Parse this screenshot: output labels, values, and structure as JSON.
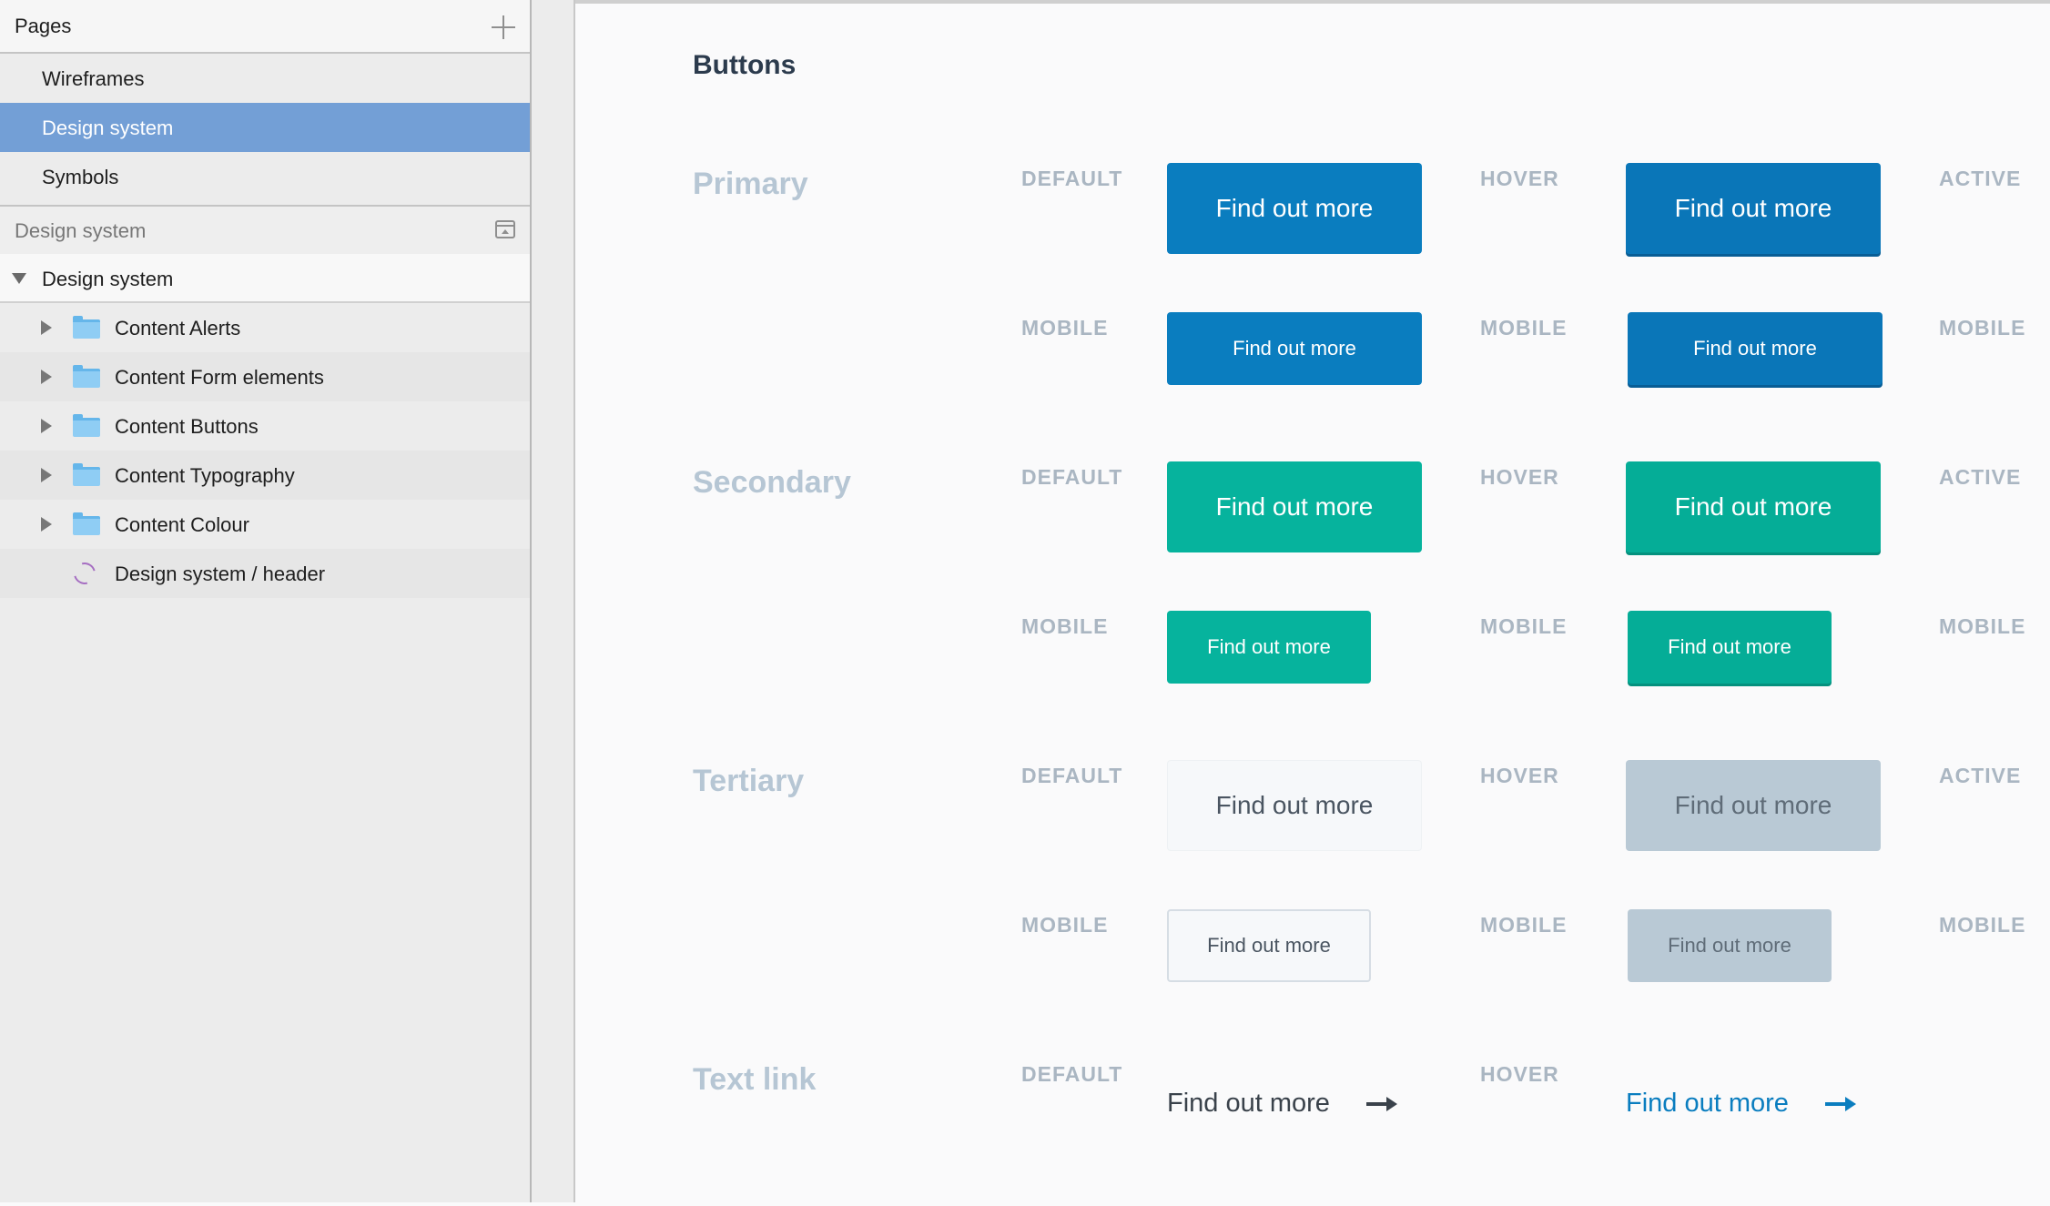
{
  "sidebar": {
    "pages_title": "Pages",
    "pages": [
      {
        "label": "Wireframes",
        "selected": false
      },
      {
        "label": "Design system",
        "selected": true
      },
      {
        "label": "Symbols",
        "selected": false
      }
    ],
    "layers_title": "Design system",
    "group_label": "Design system",
    "layers": [
      {
        "label": "Content Alerts",
        "icon": "folder-icon"
      },
      {
        "label": "Content Form elements",
        "icon": "folder-icon"
      },
      {
        "label": "Content Buttons",
        "icon": "folder-icon"
      },
      {
        "label": "Content Typography",
        "icon": "folder-icon"
      },
      {
        "label": "Content Colour",
        "icon": "folder-icon"
      },
      {
        "label": "Design system / header",
        "icon": "symbol-icon"
      }
    ]
  },
  "canvas": {
    "title": "Buttons",
    "states": {
      "default": "DEFAULT",
      "hover": "HOVER",
      "active": "ACTIVE",
      "mobile": "MOBILE"
    },
    "sections": {
      "primary": "Primary",
      "secondary": "Secondary",
      "tertiary": "Tertiary",
      "text_link": "Text link"
    },
    "button_label": "Find out more"
  },
  "colors": {
    "primary": "#0a7dbf",
    "secondary": "#06b39d",
    "tertiary_hover": "#b9c9d5",
    "selection": "#739fd6"
  }
}
